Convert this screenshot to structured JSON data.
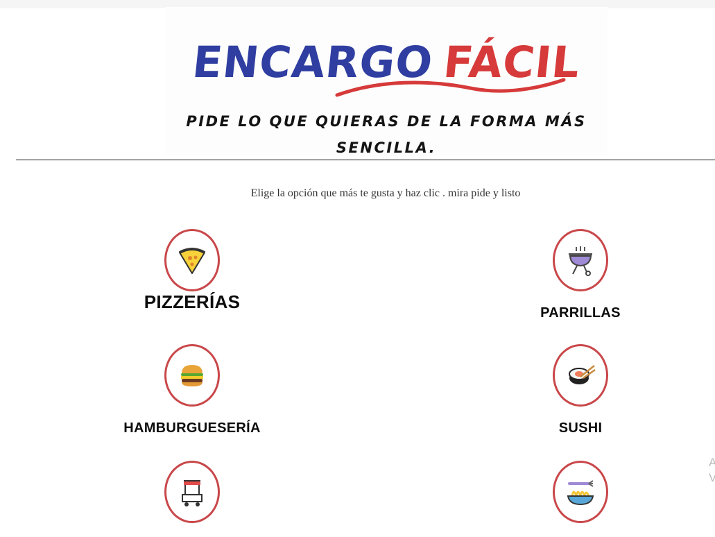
{
  "header": {
    "brand_word1": "ENCARGO",
    "brand_word2": "FÁCIL",
    "tagline_line1": "PIDE LO QUE QUIERAS DE LA FORMA MÁS",
    "tagline_line2": "SENCILLA."
  },
  "main": {
    "instruction": "Elige la opción que más te gusta y haz clic . mira pide y listo",
    "categories": [
      {
        "label": "PIZZERÍAS",
        "icon": "pizza-slice-icon"
      },
      {
        "label": "PARRILLAS",
        "icon": "grill-icon"
      },
      {
        "label": "HAMBURGUESERÍA",
        "icon": "burger-icon"
      },
      {
        "label": "SUSHI",
        "icon": "sushi-icon"
      },
      {
        "label": "",
        "icon": "food-cart-icon"
      },
      {
        "label": "",
        "icon": "noodles-icon"
      }
    ]
  },
  "edge_text": {
    "line1": "A",
    "line2": "V"
  },
  "colors": {
    "brand_blue": "#2f3ea0",
    "brand_red": "#d63a3a",
    "circle_border": "#c9474a"
  }
}
